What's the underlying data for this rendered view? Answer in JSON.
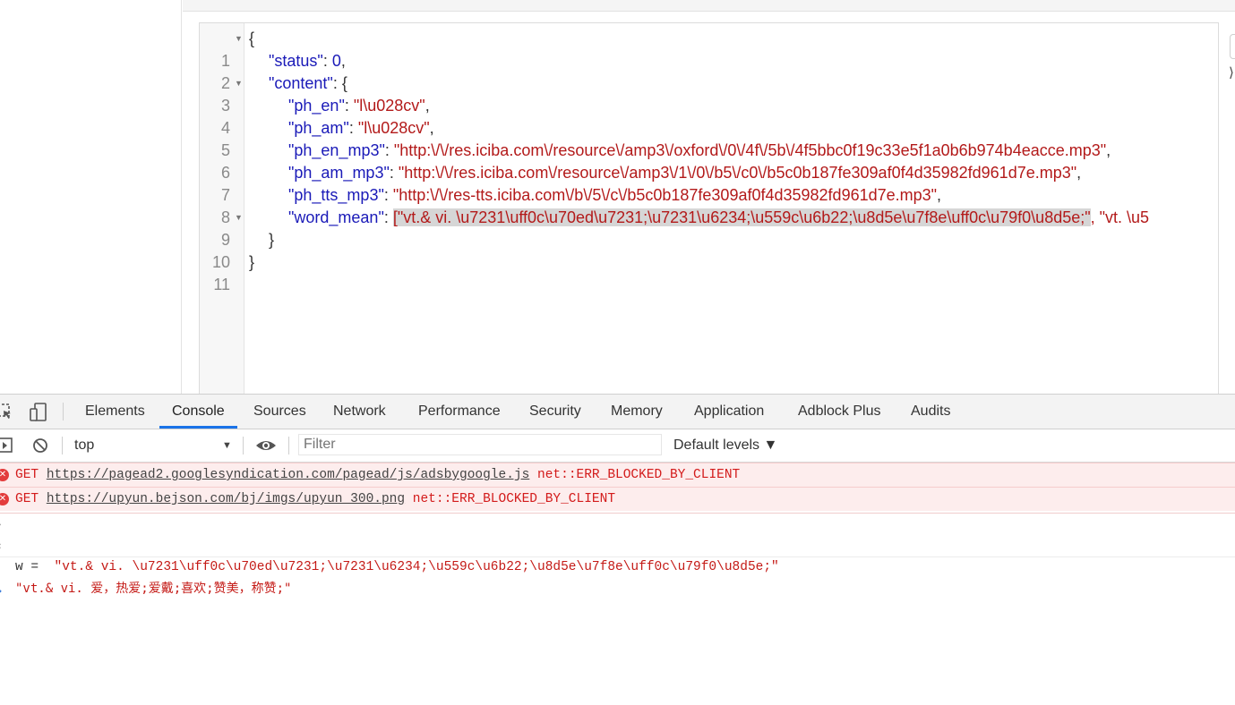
{
  "editor": {
    "lines": [
      {
        "num": "1",
        "fold": true
      },
      {
        "num": "2"
      },
      {
        "num": "3",
        "fold": true
      },
      {
        "num": "4"
      },
      {
        "num": "5"
      },
      {
        "num": "6"
      },
      {
        "num": "7"
      },
      {
        "num": "8"
      },
      {
        "num": "9",
        "fold": true
      },
      {
        "num": "10"
      },
      {
        "num": "11"
      }
    ],
    "brace_open": "{",
    "brace_close": "}",
    "status_key": "\"status\"",
    "status_val": "0",
    "content_key": "\"content\"",
    "ph_en_key": "\"ph_en\"",
    "ph_en_val": "\"l\\u028cv\"",
    "ph_am_key": "\"ph_am\"",
    "ph_am_val": "\"l\\u028cv\"",
    "ph_en_mp3_key": "\"ph_en_mp3\"",
    "ph_en_mp3_val": "\"http:\\/\\/res.iciba.com\\/resource\\/amp3\\/oxford\\/0\\/4f\\/5b\\/4f5bbc0f19c33e5f1a0b6b974b4eacce.mp3\"",
    "ph_am_mp3_key": "\"ph_am_mp3\"",
    "ph_am_mp3_val": "\"http:\\/\\/res.iciba.com\\/resource\\/amp3\\/1\\/0\\/b5\\/c0\\/b5c0b187fe309af0f4d35982fd961d7e.mp3\"",
    "ph_tts_mp3_key": "\"ph_tts_mp3\"",
    "ph_tts_mp3_val": "\"http:\\/\\/res-tts.iciba.com\\/b\\/5\\/c\\/b5c0b187fe309af0f4d35982fd961d7e.mp3\"",
    "word_mean_key": "\"word_mean\"",
    "word_mean_val_hl": "[\"vt.& vi. \\u7231\\uff0c\\u70ed\\u7231;\\u7231\\u6234;\\u559c\\u6b22;\\u8d5e\\u7f8e\\uff0c\\u79f0\\u8d5e;\"",
    "word_mean_val_rest": ", \"vt. \\u5",
    "inner_close": "}"
  },
  "devtools": {
    "tabs": [
      "Elements",
      "Console",
      "Sources",
      "Network",
      "Performance",
      "Security",
      "Memory",
      "Application",
      "Adblock Plus",
      "Audits"
    ],
    "active_tab": "Console",
    "context": "top",
    "filter_placeholder": "Filter",
    "levels": "Default levels ▼",
    "errors": [
      {
        "method": "GET",
        "url": "https://pagead2.googlesyndication.com/pagead/js/adsbygoogle.js",
        "status": "net::ERR_BLOCKED_BY_CLIENT"
      },
      {
        "method": "GET",
        "url": "https://upyun.bejson.com/bj/imgs/upyun_300.png",
        "status": "net::ERR_BLOCKED_BY_CLIENT"
      }
    ],
    "input_cmd": "w =  ",
    "input_str": "\"vt.& vi. \\u7231\\uff0c\\u70ed\\u7231;\\u7231\\u6234;\\u559c\\u6b22;\\u8d5e\\u7f8e\\uff0c\\u79f0\\u8d5e;\"",
    "output_str": "\"vt.& vi. 爱，热爱;爱戴;喜欢;赞美，称赞;\""
  },
  "colors": {
    "accent": "#1a73e8",
    "error_bg": "#fdeded",
    "error_text": "#d31b1b",
    "string": "#c41a16"
  }
}
